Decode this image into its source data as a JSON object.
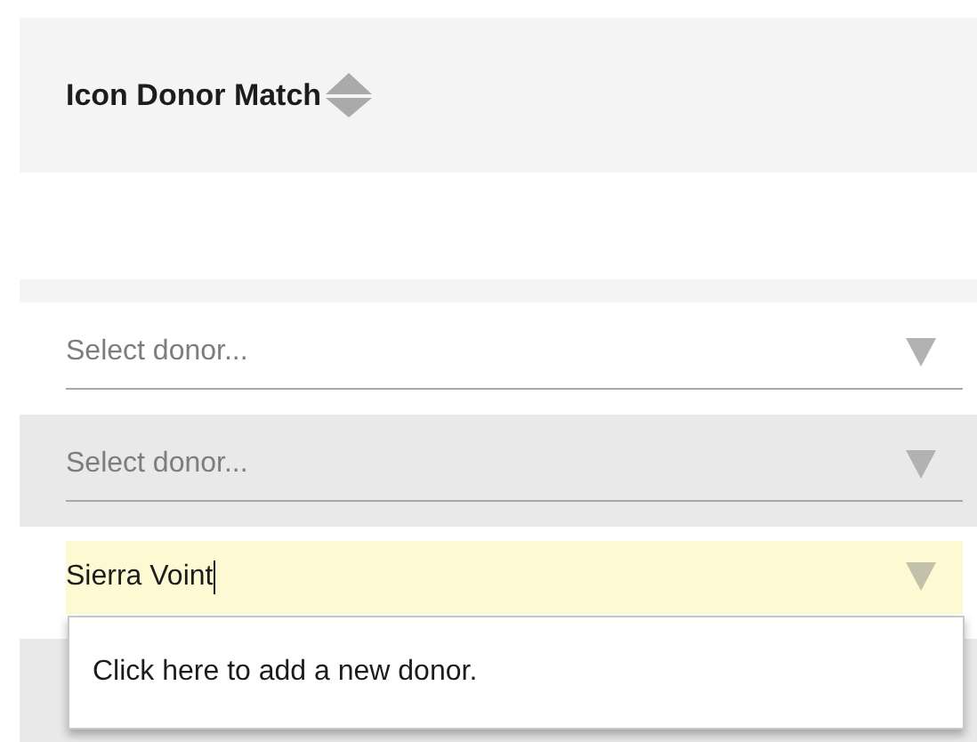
{
  "header": {
    "title": "Icon Donor Match"
  },
  "rows": [
    {
      "field": {
        "placeholder": "Select donor...",
        "focused": false
      }
    },
    {
      "field": {
        "placeholder": "Select donor...",
        "focused": false
      }
    },
    {
      "field": {
        "value": "Sierra Voint",
        "focused": true
      },
      "dropdown": {
        "option": "Click here to add a new donor."
      }
    },
    {}
  ]
}
